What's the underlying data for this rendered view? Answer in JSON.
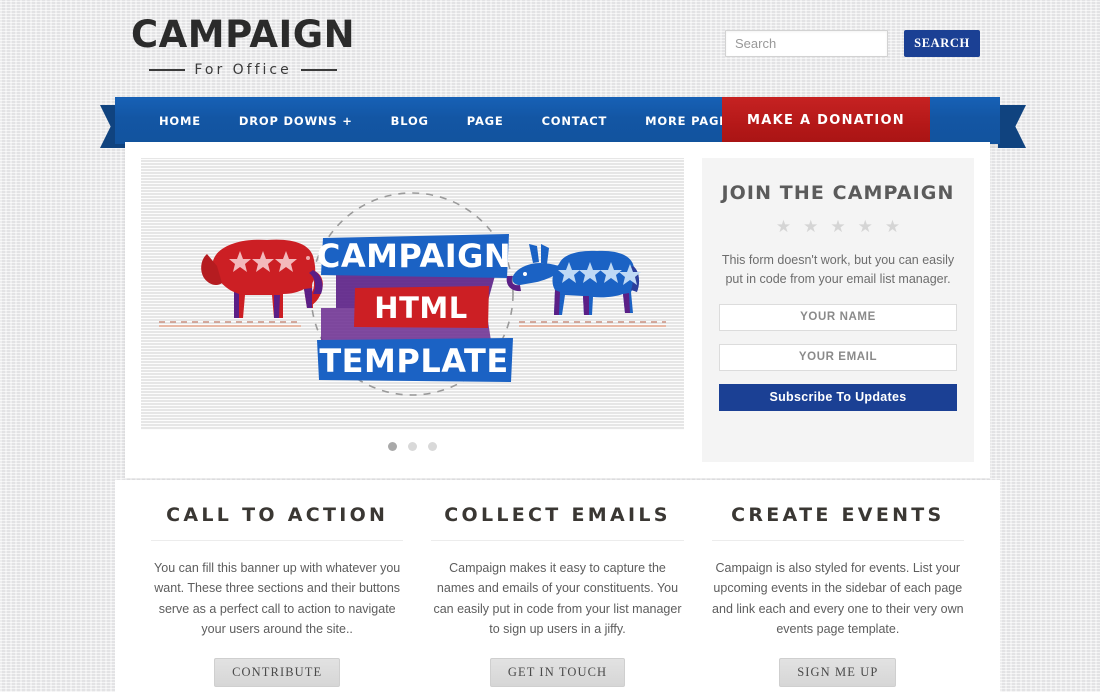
{
  "site": {
    "logo_main": "CAMPAIGN",
    "logo_sub": "For Office"
  },
  "search": {
    "placeholder": "Search",
    "value": "",
    "button_label": "SEARCH"
  },
  "nav": {
    "items": [
      {
        "label": "HOME"
      },
      {
        "label": "DROP DOWNS +"
      },
      {
        "label": "BLOG"
      },
      {
        "label": "PAGE"
      },
      {
        "label": "CONTACT"
      },
      {
        "label": "MORE PAGE LAYOUTS +"
      }
    ],
    "donation_label": "MAKE A DONATION"
  },
  "slider": {
    "banner_line1": "CAMPAIGN",
    "banner_line2": "HTML",
    "banner_line3": "TEMPLATE",
    "left_mascot": "republican-elephant",
    "right_mascot": "democrat-donkey",
    "left_mascot_stars": 3,
    "right_mascot_stars": 4,
    "dots": [
      {
        "active": true
      },
      {
        "active": false
      },
      {
        "active": false
      }
    ]
  },
  "sidebar": {
    "title": "JOIN THE CAMPAIGN",
    "stars": 5,
    "description": "This form doesn't work, but you can easily put in code from your email list manager.",
    "name_placeholder": "YOUR NAME",
    "name_value": "",
    "email_placeholder": "YOUR EMAIL",
    "email_value": "",
    "subscribe_label": "Subscribe To Updates"
  },
  "cta": {
    "columns": [
      {
        "title": "CALL TO ACTION",
        "text": "You can fill this banner up with whatever you want. These three sections and their buttons serve as a perfect call to action to navigate your users around the site..",
        "button": "CONTRIBUTE"
      },
      {
        "title": "COLLECT EMAILS",
        "text": "Campaign makes it easy to capture the names and emails of your constituents. You can easily put in code from your list manager to sign up users in a jiffy.",
        "button": "GET IN TOUCH"
      },
      {
        "title": "CREATE EVENTS",
        "text": "Campaign is also styled for events. List your upcoming events in the sidebar of each page and link each and every one to their very own events page template.",
        "button": "SIGN ME UP"
      }
    ]
  },
  "colors": {
    "nav_blue": "#1356a4",
    "ribbon_blue": "#10437f",
    "donation_red": "#b41818",
    "button_blue": "#1b4094",
    "republican_red": "#cc1f24",
    "democrat_blue": "#1b62c4"
  }
}
